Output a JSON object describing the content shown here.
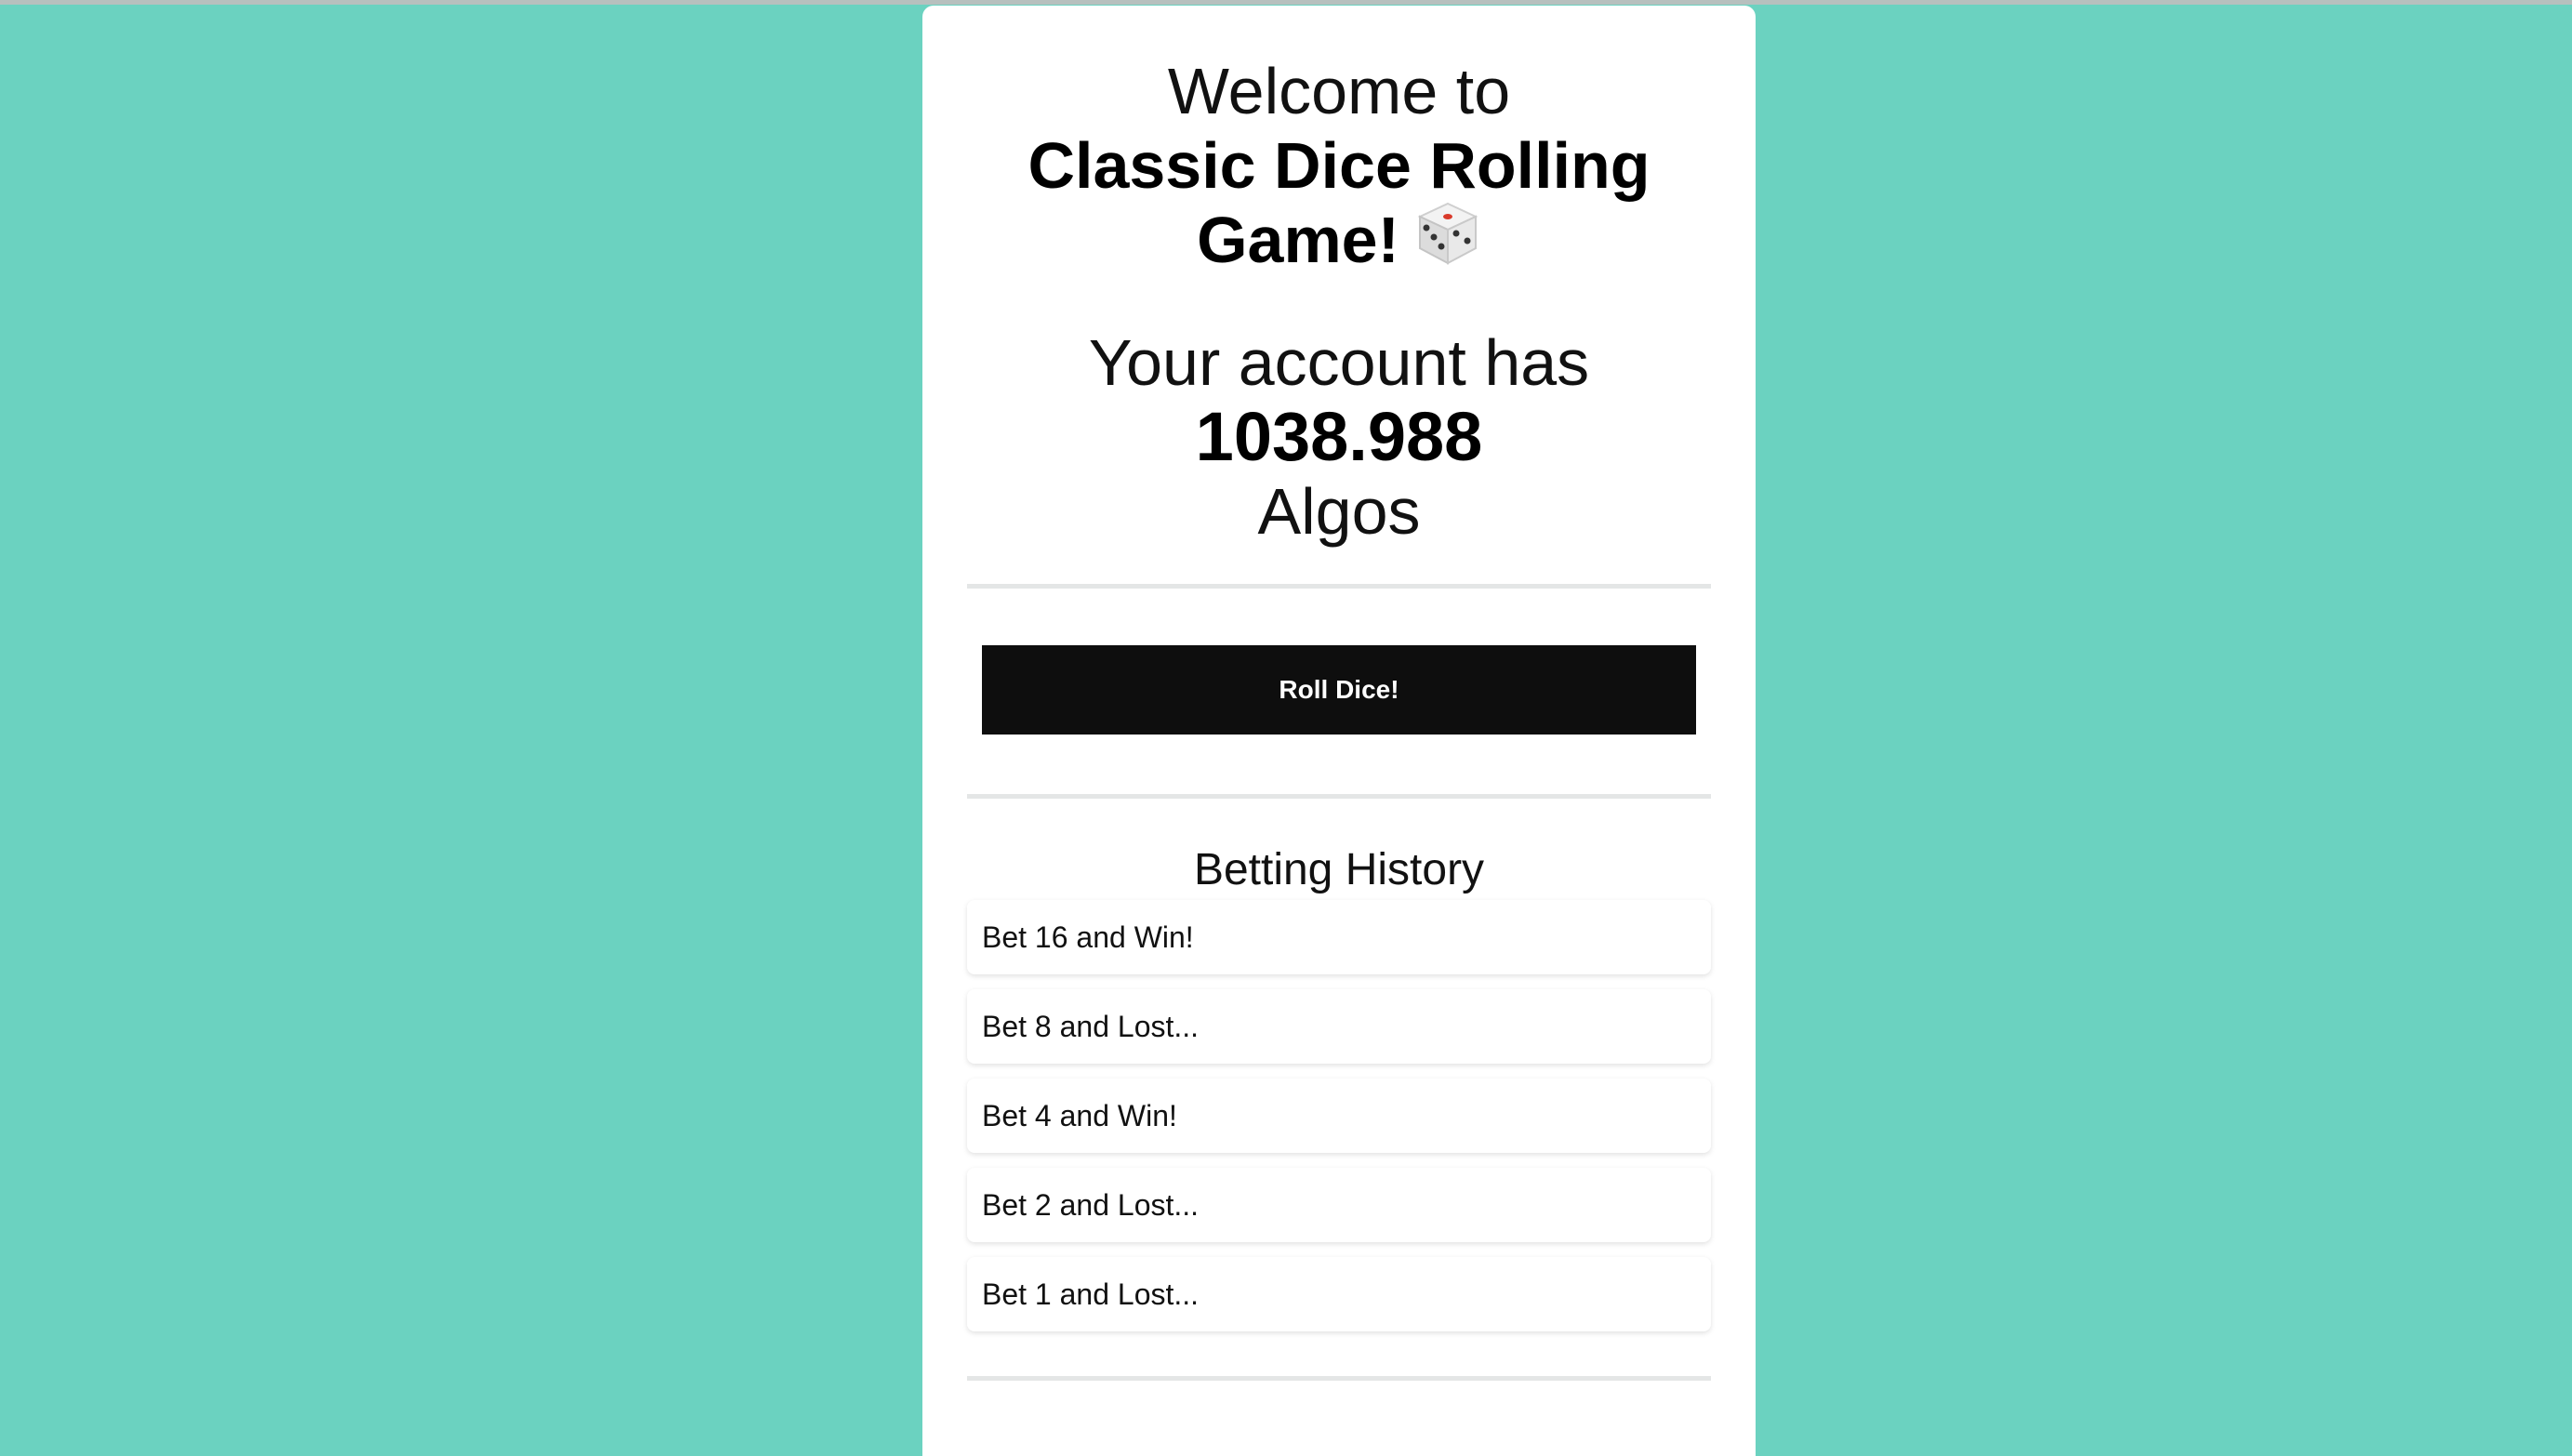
{
  "header": {
    "welcome": "Welcome to",
    "title": "Classic Dice Rolling Game!",
    "dice_icon": "game-die-icon"
  },
  "account": {
    "prefix": "Your account has",
    "balance": "1038.988",
    "currency": "Algos"
  },
  "actions": {
    "roll_label": "Roll Dice!"
  },
  "history": {
    "title": "Betting History",
    "items": [
      "Bet 16 and Win!",
      "Bet 8 and Lost...",
      "Bet 4 and Win!",
      "Bet 2 and Lost...",
      "Bet 1 and Lost..."
    ]
  },
  "colors": {
    "background": "#6bd2c0",
    "card": "#ffffff",
    "button": "#0e0e0e"
  }
}
